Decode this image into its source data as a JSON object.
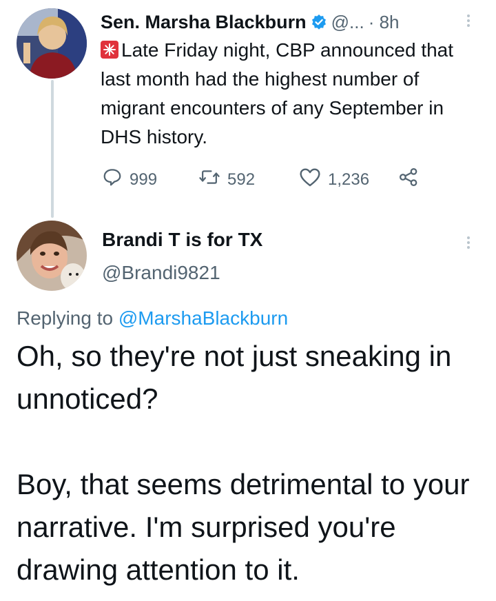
{
  "tweet": {
    "display_name": "Sen. Marsha Blackburn",
    "handle": "@...",
    "time": "· 8h",
    "text": "Late Friday night, CBP announced that last month had the highest number of migrant encounters of any September in DHS history.",
    "icons": {
      "emoji": "police-light-icon",
      "verified": "verified-badge-icon",
      "more": "more-vertical-icon"
    },
    "actions": {
      "replies": "999",
      "retweets": "592",
      "likes": "1,236"
    }
  },
  "reply": {
    "display_name": "Brandi T is for TX",
    "handle": "@Brandi9821",
    "replying_prefix": "Replying to",
    "replying_to": "@MarshaBlackburn",
    "text_para1": "Oh, so they're not just sneaking in unnoticed?",
    "text_para2": "Boy, that seems detrimental to your narrative. I'm surprised you're drawing attention to it."
  },
  "colors": {
    "accent": "#1d9bf0",
    "muted": "#536471",
    "text": "#0f1419"
  }
}
